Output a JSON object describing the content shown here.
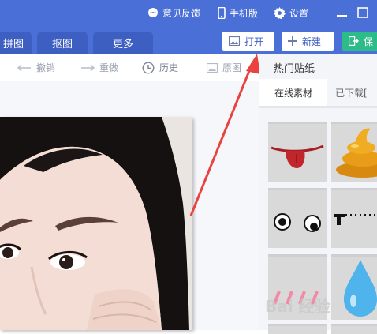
{
  "topbar": {
    "feedback": "意见反馈",
    "mobile": "手机版",
    "settings": "设置"
  },
  "tabs": [
    {
      "label": "拼图"
    },
    {
      "label": "抠图"
    },
    {
      "label": "更多"
    }
  ],
  "actions": {
    "open": "打开",
    "new": "新建",
    "save": "保"
  },
  "toolbar": {
    "undo": "撤销",
    "redo": "重做",
    "history": "历史",
    "original": "原图"
  },
  "panel": {
    "title": "热门贴纸",
    "tab_online": "在线素材",
    "tab_downloaded": "已下载["
  },
  "watermark": "Bai 经验",
  "colors": {
    "titlebar": "#4a6fd6",
    "save_button": "#2dbb8a",
    "arrow": "#e8433f"
  }
}
